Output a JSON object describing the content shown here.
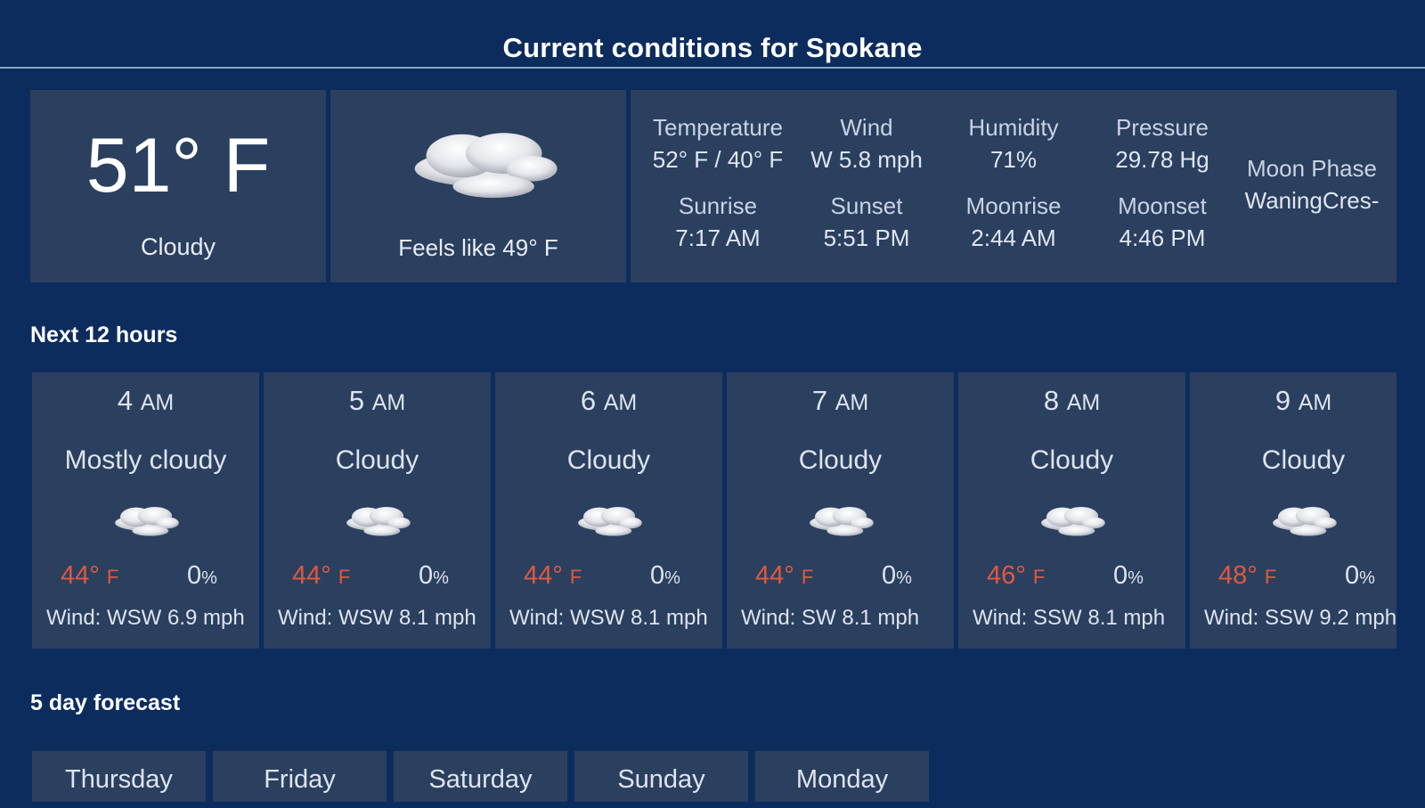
{
  "header": {
    "title": "Current conditions for Spokane"
  },
  "current": {
    "temperature": "51° F",
    "condition": "Cloudy",
    "icon": "cloudy-icon",
    "feels_like": "Feels like 49° F",
    "details": {
      "temperature": {
        "label": "Temperature",
        "value": "52° F / 40° F"
      },
      "wind": {
        "label": "Wind",
        "value": "W 5.8 mph"
      },
      "humidity": {
        "label": "Humidity",
        "value": "71%"
      },
      "pressure": {
        "label": "Pressure",
        "value": "29.78 Hg"
      },
      "sunrise": {
        "label": "Sunrise",
        "value": "7:17 AM"
      },
      "sunset": {
        "label": "Sunset",
        "value": "5:51 PM"
      },
      "moonrise": {
        "label": "Moonrise",
        "value": "2:44 AM"
      },
      "moonset": {
        "label": "Moonset",
        "value": "4:46 PM"
      },
      "moon_phase": {
        "label": "Moon Phase",
        "value": "WaningCres-"
      }
    }
  },
  "hourly": {
    "heading": "Next 12 hours",
    "items": [
      {
        "hour": "4",
        "ampm": "AM",
        "condition": "Mostly cloudy",
        "temp": "44°",
        "unit": "F",
        "precip": "0",
        "pct": "%",
        "wind": "Wind: WSW 6.9 mph",
        "icon": "mostly-cloudy-icon"
      },
      {
        "hour": "5",
        "ampm": "AM",
        "condition": "Cloudy",
        "temp": "44°",
        "unit": "F",
        "precip": "0",
        "pct": "%",
        "wind": "Wind: WSW 8.1 mph",
        "icon": "cloudy-icon"
      },
      {
        "hour": "6",
        "ampm": "AM",
        "condition": "Cloudy",
        "temp": "44°",
        "unit": "F",
        "precip": "0",
        "pct": "%",
        "wind": "Wind: WSW 8.1 mph",
        "icon": "cloudy-icon"
      },
      {
        "hour": "7",
        "ampm": "AM",
        "condition": "Cloudy",
        "temp": "44°",
        "unit": "F",
        "precip": "0",
        "pct": "%",
        "wind": "Wind: SW 8.1 mph",
        "icon": "cloudy-icon"
      },
      {
        "hour": "8",
        "ampm": "AM",
        "condition": "Cloudy",
        "temp": "46°",
        "unit": "F",
        "precip": "0",
        "pct": "%",
        "wind": "Wind: SSW 8.1 mph",
        "icon": "cloudy-icon"
      },
      {
        "hour": "9",
        "ampm": "AM",
        "condition": "Cloudy",
        "temp": "48°",
        "unit": "F",
        "precip": "0",
        "pct": "%",
        "wind": "Wind: SSW 9.2 mph",
        "icon": "cloudy-icon"
      }
    ]
  },
  "forecast": {
    "heading": "5 day forecast",
    "days": [
      "Thursday",
      "Friday",
      "Saturday",
      "Sunday",
      "Monday"
    ]
  },
  "colors": {
    "background": "#0d2c5e",
    "panel": "#2b3f5f",
    "temp_accent": "#e2583e"
  }
}
